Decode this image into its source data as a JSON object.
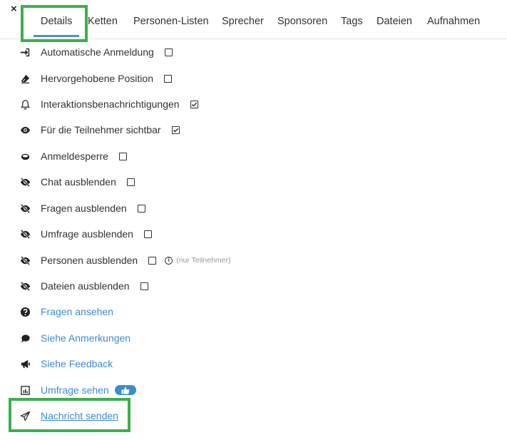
{
  "close_label": "×",
  "tabs": [
    {
      "label": "Details"
    },
    {
      "label": "Ketten"
    },
    {
      "label": "Personen-Listen"
    },
    {
      "label": "Sprecher"
    },
    {
      "label": "Sponsoren"
    },
    {
      "label": "Tags"
    },
    {
      "label": "Dateien"
    },
    {
      "label": "Aufnahmen"
    }
  ],
  "active_tab": "Details",
  "settings": [
    {
      "label": "Automatische Anmeldung",
      "icon": "sign-in-icon",
      "checked": false
    },
    {
      "label": "Hervorgehobene Position",
      "icon": "eraser-icon",
      "checked": false
    },
    {
      "label": "Interaktionsbenachrichtigungen",
      "icon": "bell-icon",
      "checked": true
    },
    {
      "label": "Für die Teilnehmer sichtbar",
      "icon": "eye-icon",
      "checked": true
    },
    {
      "label": "Anmeldesperre",
      "icon": "ring-icon",
      "checked": false
    },
    {
      "label": "Chat ausblenden",
      "icon": "eye-slash-icon",
      "checked": false
    },
    {
      "label": "Fragen ausblenden",
      "icon": "eye-slash-icon",
      "checked": false
    },
    {
      "label": "Umfrage ausblenden",
      "icon": "eye-slash-icon",
      "checked": false
    },
    {
      "label": "Personen ausblenden",
      "icon": "eye-slash-icon",
      "checked": false,
      "note": "(nur Teilnehmer)"
    },
    {
      "label": "Dateien ausblenden",
      "icon": "eye-slash-icon",
      "checked": false
    }
  ],
  "links": [
    {
      "label": "Fragen ansehen",
      "icon": "question-circle-icon"
    },
    {
      "label": "Siehe Anmerkungen",
      "icon": "comment-icon"
    },
    {
      "label": "Siehe Feedback",
      "icon": "bullhorn-icon"
    },
    {
      "label": "Umfrage sehen",
      "icon": "bar-chart-icon",
      "badge": "thumbs-up-icon"
    },
    {
      "label": "Nachricht senden",
      "icon": "paper-plane-icon"
    }
  ],
  "colors": {
    "link": "#3d8bd4",
    "highlight": "#3cb04e",
    "tab_underline": "#4a90d9"
  }
}
